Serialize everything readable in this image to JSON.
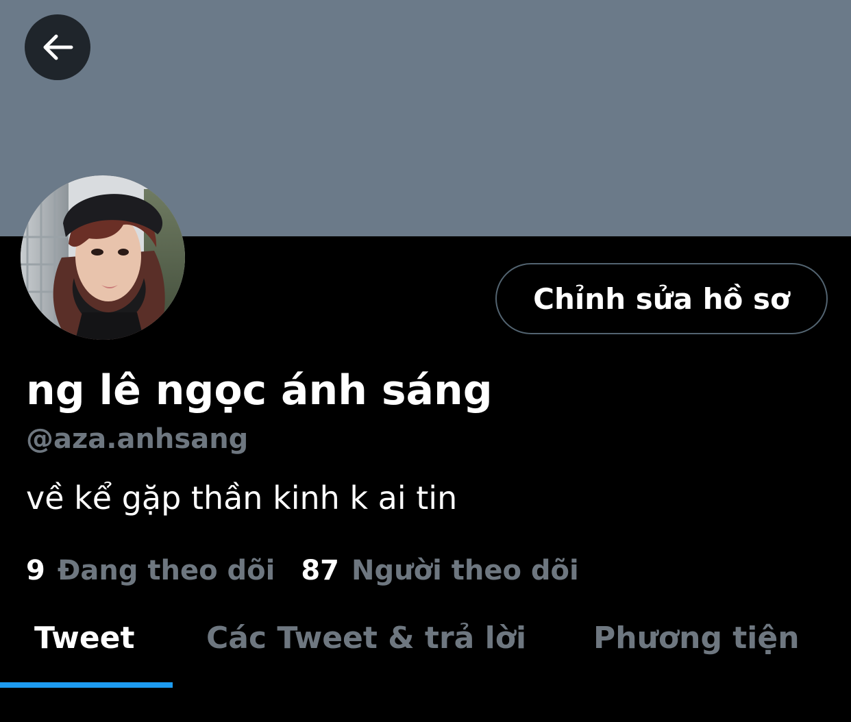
{
  "colors": {
    "banner": "#6b7a89",
    "background": "#000000",
    "muted_text": "#6e7780",
    "accent": "#1d9bf0"
  },
  "header": {
    "back_icon": "arrow-left-icon"
  },
  "profile": {
    "edit_button_label": "Chỉnh sửa hồ sơ",
    "display_name": "ng lê ngọc ánh sáng",
    "handle": "@aza.anhsang",
    "bio": "về kể gặp thần kinh k ai tin"
  },
  "stats": {
    "following_count": "9",
    "following_label": "Đang theo dõi",
    "followers_count": "87",
    "followers_label": "Người theo dõi"
  },
  "tabs": [
    {
      "label": "Tweet",
      "active": true
    },
    {
      "label": "Các Tweet & trả lời",
      "active": false
    },
    {
      "label": "Phương tiện",
      "active": false
    }
  ]
}
